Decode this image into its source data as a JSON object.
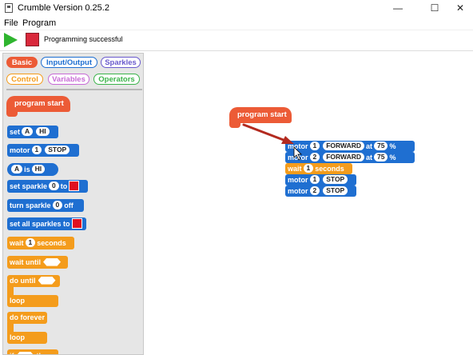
{
  "window": {
    "title": "Crumble Version 0.25.2",
    "minimize_glyph": "—",
    "maximize_glyph": "☐",
    "close_glyph": "✕"
  },
  "menu": [
    {
      "label": "File"
    },
    {
      "label": "Program"
    }
  ],
  "toolbar": {
    "status": "Programming successful"
  },
  "palette": {
    "tabs": [
      {
        "label": "Basic",
        "color": "#ec5b36",
        "active": true
      },
      {
        "label": "Input/Output",
        "color": "#1f6fd1"
      },
      {
        "label": "Sparkles",
        "color": "#6a5acd"
      },
      {
        "label": "Control",
        "color": "#f49c1c"
      },
      {
        "label": "Variables",
        "color": "#c86bd6"
      },
      {
        "label": "Operators",
        "color": "#3cb44b"
      }
    ],
    "blocks": {
      "program_start": "program start",
      "set_word": "set",
      "set_var": "A",
      "set_val": "HI",
      "motor_word": "motor",
      "motor_num": "1",
      "motor_state": "STOP",
      "cond_var": "A",
      "cond_is": "is",
      "cond_val": "HI",
      "sparkle_word": "set sparkle",
      "sparkle_num": "0",
      "sparkle_to": "to",
      "turn_word": "turn sparkle",
      "turn_num": "0",
      "turn_off": "off",
      "all_word": "set all sparkles to",
      "wait_word": "wait",
      "wait_num": "1",
      "wait_unit": "seconds",
      "wait_until": "wait until",
      "do_until": "do until",
      "loop1": "loop",
      "do_forever": "do forever",
      "loop2": "loop",
      "if_word": "if",
      "then_word": "then"
    }
  },
  "program": {
    "start": "program start",
    "lines": [
      {
        "kind": "motor",
        "word": "motor",
        "num": "1",
        "dir": "FORWARD",
        "at": "at",
        "speed": "75",
        "unit": "%"
      },
      {
        "kind": "motor",
        "word": "motor",
        "num": "2",
        "dir": "FORWARD",
        "at": "at",
        "speed": "75",
        "unit": "%"
      },
      {
        "kind": "wait",
        "word": "wait",
        "num": "1",
        "unit": "seconds"
      },
      {
        "kind": "stop",
        "word": "motor",
        "num": "1",
        "state": "STOP"
      },
      {
        "kind": "stop",
        "word": "motor",
        "num": "2",
        "state": "STOP"
      }
    ]
  },
  "colors": {
    "blue": "#1f6fd1",
    "orange": "#f49c1c",
    "red": "#ec5b36",
    "arrow": "#b32a1f",
    "play": "#2fb52f",
    "stop": "#d9283b"
  }
}
